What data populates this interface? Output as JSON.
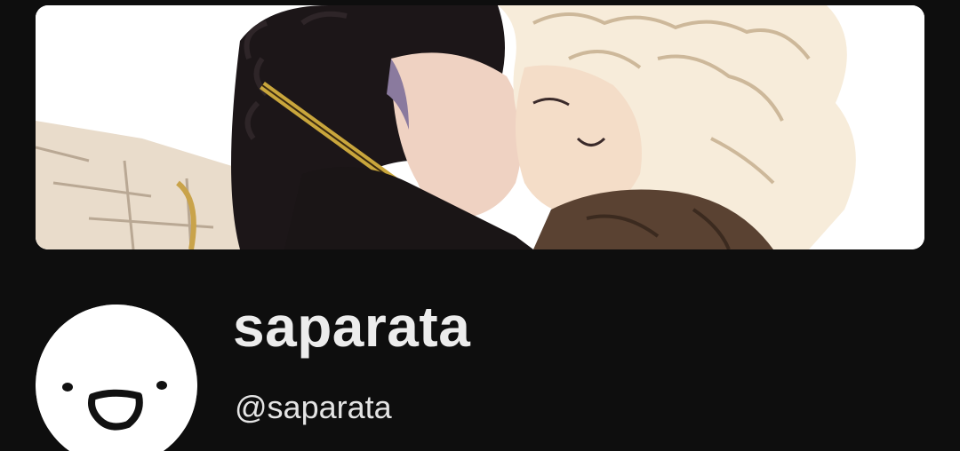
{
  "profile": {
    "display_name": "saparata",
    "handle": "@saparata"
  },
  "banner": {
    "icon": "artwork-illustration"
  },
  "avatar": {
    "icon": "smiley-face-icon"
  },
  "colors": {
    "background": "#0e0e0e",
    "text_primary": "#ececec",
    "text_secondary": "#e4e4e4",
    "avatar_bg": "#ffffff"
  }
}
